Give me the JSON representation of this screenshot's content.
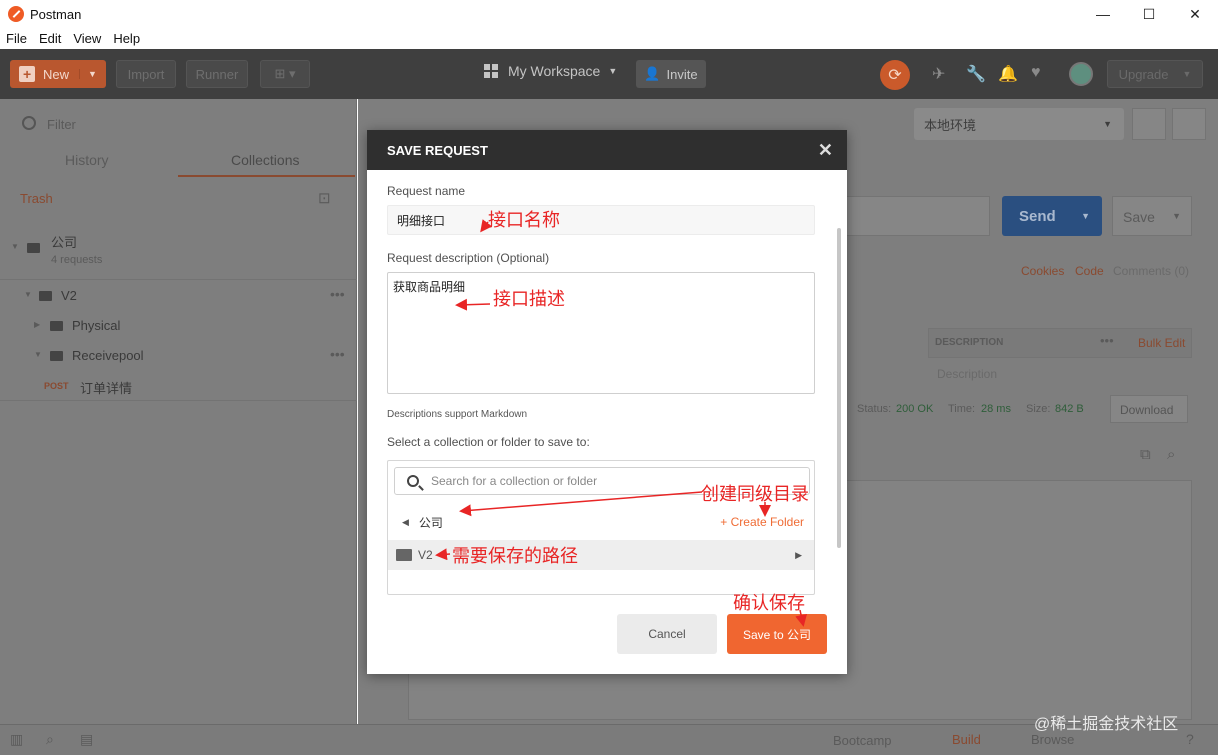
{
  "window": {
    "title": "Postman",
    "minimize": "—",
    "maximize": "☐",
    "close": "✕"
  },
  "menu": [
    "File",
    "Edit",
    "View",
    "Help"
  ],
  "toolbar": {
    "new_label": "New",
    "import_label": "Import",
    "runner_label": "Runner",
    "workspace_label": "My Workspace",
    "invite_label": "Invite",
    "upgrade_label": "Upgrade"
  },
  "sidebar": {
    "filter_placeholder": "Filter",
    "tabs": [
      "History",
      "Collections"
    ],
    "trash_label": "Trash",
    "collection": {
      "name": "公司",
      "count": "4 requests"
    },
    "tree": [
      {
        "name": "V2"
      },
      {
        "name": "Physical"
      },
      {
        "name": "Receivepool"
      }
    ],
    "request": {
      "method": "POST",
      "name": "订单详情"
    }
  },
  "main": {
    "environment": "本地环境",
    "send_label": "Send",
    "save_label": "Save",
    "cookies_label": "Cookies",
    "code_label": "Code",
    "comments_label": "Comments (0)",
    "description_header": "DESCRIPTION",
    "bulk_edit_label": "Bulk Edit",
    "description_placeholder": "Description",
    "status_label": "Status:",
    "status_value": "200 OK",
    "time_label": "Time:",
    "time_value": "28 ms",
    "size_label": "Size:",
    "size_value": "842 B",
    "download_label": "Download"
  },
  "statusbar": {
    "bootcamp_label": "Bootcamp",
    "build_label": "Build",
    "browse_label": "Browse"
  },
  "modal": {
    "title": "SAVE REQUEST",
    "name_label": "Request name",
    "name_value": "明细接口",
    "description_label": "Request description (Optional)",
    "description_value": "获取商品明细",
    "markdown_hint": "Descriptions support Markdown",
    "select_label": "Select a collection or folder to save to:",
    "search_placeholder": "Search for a collection or folder",
    "current_collection": "公司",
    "create_folder_label": "+ Create Folder",
    "folder_name": "V2",
    "cancel_label": "Cancel",
    "save_button_label": "Save to 公司"
  },
  "annotations": {
    "name_note": "接口名称",
    "desc_note": "接口描述",
    "create_note": "创建同级目录",
    "path_note": "需要保存的路径",
    "confirm_note": "确认保存"
  },
  "watermark": "@稀土掘金技术社区",
  "colors": {
    "accent": "#f06630",
    "send_blue": "#2a4f80",
    "annotation_red": "#e82525"
  }
}
